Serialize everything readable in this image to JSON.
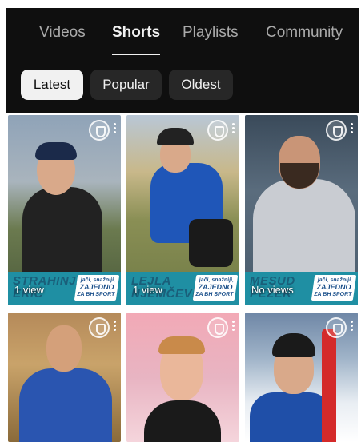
{
  "tabs": [
    {
      "label": "Videos",
      "active": false
    },
    {
      "label": "Shorts",
      "active": true
    },
    {
      "label": "Playlists",
      "active": false
    },
    {
      "label": "Community",
      "active": false
    }
  ],
  "filters": [
    {
      "label": "Latest",
      "selected": true
    },
    {
      "label": "Popular",
      "selected": false
    },
    {
      "label": "Oldest",
      "selected": false
    }
  ],
  "shorts": [
    {
      "name_line1": "STRAHINJA",
      "name_line2": "ERIĆ",
      "views": "1 view",
      "tag_line1": "jači, snažniji,",
      "tag_line2": "ZAJEDNO",
      "tag_line3": "ZA BH SPORT"
    },
    {
      "name_line1": "LEJLA",
      "name_line2": "NJEMČEVIĆ",
      "views": "1 view",
      "tag_line1": "jači, snažniji,",
      "tag_line2": "ZAJEDNO",
      "tag_line3": "ZA BH SPORT"
    },
    {
      "name_line1": "MESUD",
      "name_line2": "PEZER",
      "views": "No views",
      "tag_line1": "jači, snažniji,",
      "tag_line2": "ZAJEDNO",
      "tag_line3": "ZA BH SPORT"
    },
    {
      "name_line1": "",
      "name_line2": "",
      "views": ""
    },
    {
      "name_line1": "",
      "name_line2": "",
      "views": ""
    },
    {
      "name_line1": "",
      "name_line2": "",
      "views": ""
    }
  ],
  "colors": {
    "background": "#0f0f0f",
    "chip_selected": "#f1f1f1",
    "chip": "#272727",
    "banner": "#1f8fa3"
  }
}
